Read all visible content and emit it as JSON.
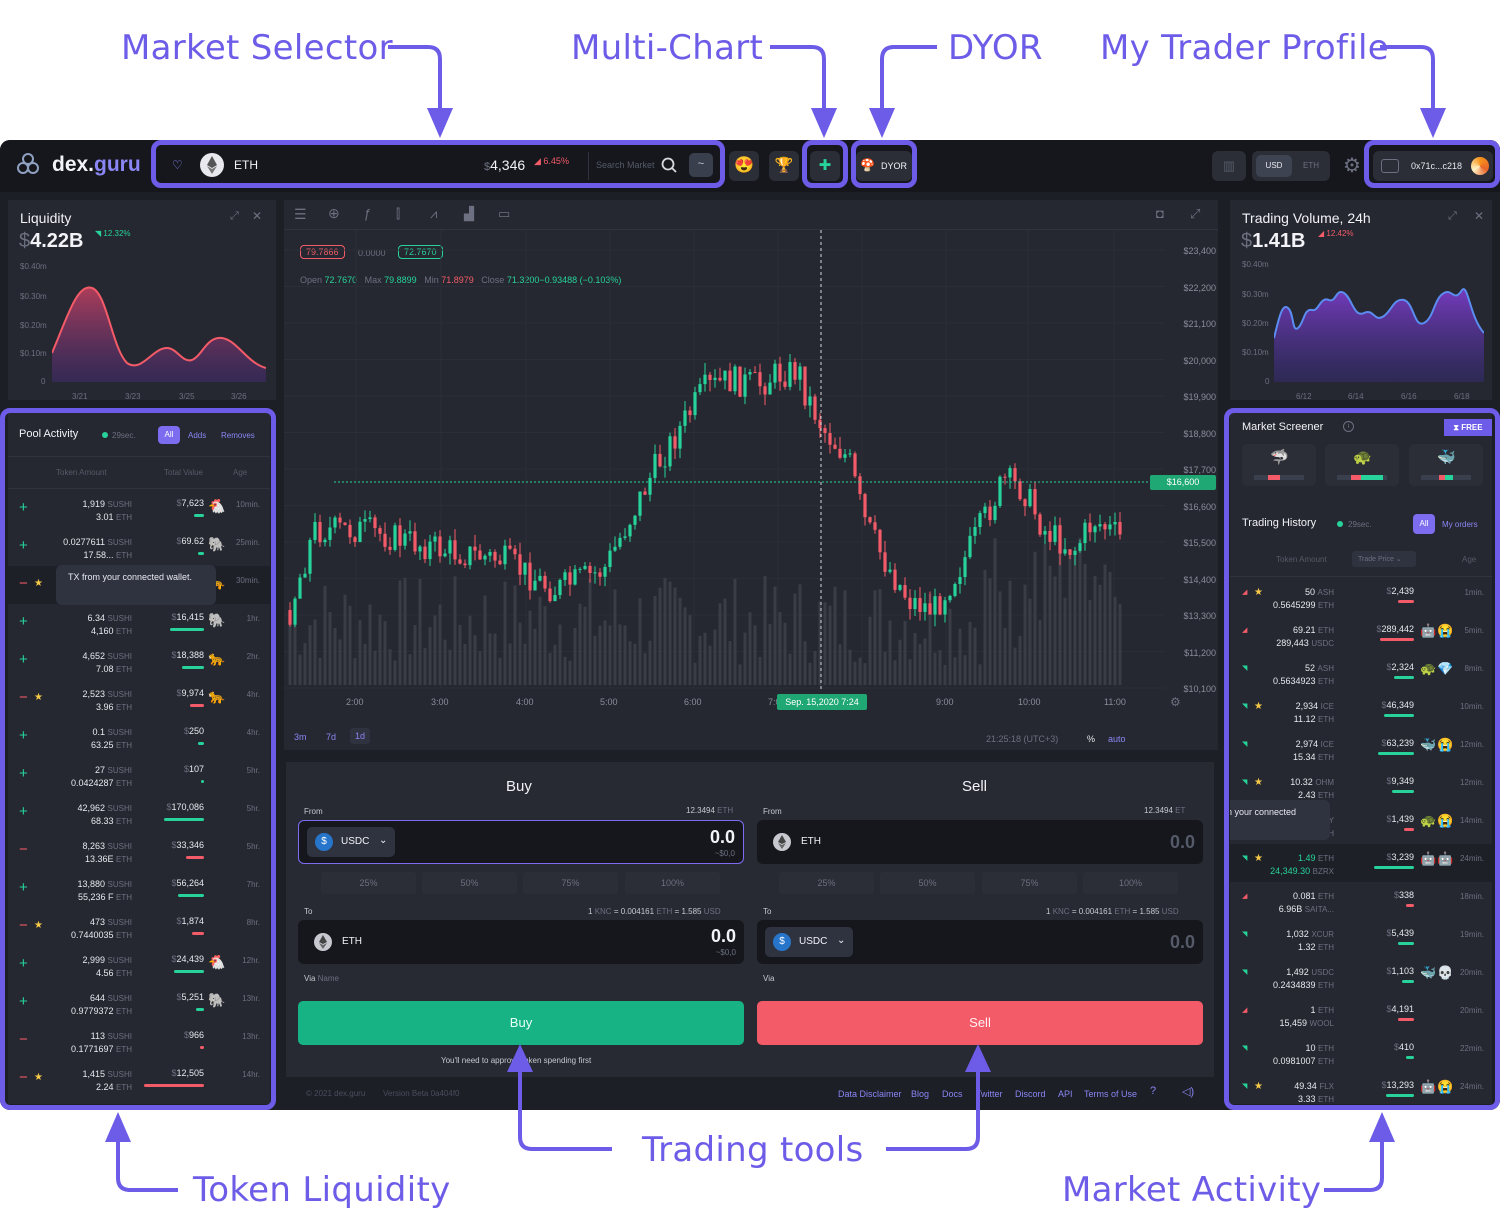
{
  "callouts": {
    "market_selector": "Market Selector",
    "multi_chart": "Multi-Chart",
    "dyor": "DYOR",
    "trader_profile": "My Trader Profile",
    "token_liquidity": "Token Liquidity",
    "trading_tools": "Trading tools",
    "market_activity": "Market Activity"
  },
  "header": {
    "logo_text": "dex.",
    "logo_accent": "guru",
    "token": "ETH",
    "price_symbol": "$",
    "price": "4,346",
    "change": "6.45%",
    "search_placeholder": "Search Market",
    "dyor_label": "DYOR",
    "currency_usd": "USD",
    "currency_eth": "ETH",
    "wallet": "0x71c...c218"
  },
  "liquidity": {
    "title": "Liquidity",
    "value": "4.22B",
    "change": "12.32%",
    "y_ticks": [
      "$0.40m",
      "$0.30m",
      "$0.20m",
      "$0.10m",
      "0"
    ],
    "x_ticks": [
      "3/21",
      "3/23",
      "3/25",
      "3/26"
    ]
  },
  "volume": {
    "title": "Trading Volume, 24h",
    "value": "1.41B",
    "change": "12.42%",
    "y_ticks": [
      "$0.40m",
      "$0.30m",
      "$0.20m",
      "$0.10m",
      "0"
    ],
    "x_ticks": [
      "6/12",
      "6/14",
      "6/16",
      "6/18"
    ]
  },
  "pool": {
    "title": "Pool Activity",
    "updated": "29sec.",
    "filters": [
      "All",
      "Adds",
      "Removes"
    ],
    "col_amount": "Token Amount",
    "col_value": "Total Value",
    "col_age": "Age",
    "tooltip": "TX from your connected wallet.",
    "rows": [
      {
        "sign": "+",
        "a1": "1,919",
        "u1": "SUSHI",
        "a2": "3.01",
        "u2": "ETH",
        "val": "7,623",
        "age": "10min.",
        "icon": "🐔",
        "star": false
      },
      {
        "sign": "+",
        "a1": "0.0277611",
        "u1": "SUSHI",
        "a2": "17.58...",
        "u2": "ETH",
        "val": "69.62",
        "age": "25min.",
        "icon": "🐘",
        "star": false
      },
      {
        "sign": "−",
        "a1": "",
        "u1": "",
        "a2": "",
        "u2": "",
        "val": "",
        "age": "30min.",
        "icon": "🐆",
        "star": true
      },
      {
        "sign": "+",
        "a1": "6.34",
        "u1": "SUSHI",
        "a2": "4,160",
        "u2": "ETH",
        "val": "16,415",
        "age": "1hr.",
        "icon": "🐘",
        "star": false
      },
      {
        "sign": "+",
        "a1": "4,652",
        "u1": "SUSHI",
        "a2": "7.08",
        "u2": "ETH",
        "val": "18,388",
        "age": "2hr.",
        "icon": "🐆",
        "star": false
      },
      {
        "sign": "−",
        "a1": "2,523",
        "u1": "SUSHI",
        "a2": "3.96",
        "u2": "ETH",
        "val": "9,974",
        "age": "4hr.",
        "icon": "🐆",
        "star": true
      },
      {
        "sign": "+",
        "a1": "0.1",
        "u1": "SUSHI",
        "a2": "63.25",
        "u2": "ETH",
        "val": "250",
        "age": "4hr.",
        "icon": "",
        "star": false
      },
      {
        "sign": "+",
        "a1": "27",
        "u1": "SUSHI",
        "a2": "0.0424287",
        "u2": "ETH",
        "val": "107",
        "age": "5hr.",
        "icon": "",
        "star": false
      },
      {
        "sign": "+",
        "a1": "42,962",
        "u1": "SUSHI",
        "a2": "68.33",
        "u2": "ETH",
        "val": "170,086",
        "age": "5hr.",
        "icon": "",
        "star": false
      },
      {
        "sign": "−",
        "a1": "8,263",
        "u1": "SUSHI",
        "a2": "13.36E",
        "u2": "ETH",
        "val": "33,346",
        "age": "5hr.",
        "icon": "",
        "star": false
      },
      {
        "sign": "+",
        "a1": "13,880",
        "u1": "SUSHI",
        "a2": "55,236 F",
        "u2": "ETH",
        "val": "56,264",
        "age": "7hr.",
        "icon": "",
        "star": false
      },
      {
        "sign": "−",
        "a1": "473",
        "u1": "SUSHI",
        "a2": "0.7440035",
        "u2": "ETH",
        "val": "1,874",
        "age": "8hr.",
        "icon": "",
        "star": true
      },
      {
        "sign": "+",
        "a1": "2,999",
        "u1": "SUSHI",
        "a2": "4.56",
        "u2": "ETH",
        "val": "24,439",
        "age": "12hr.",
        "icon": "🐔",
        "star": false
      },
      {
        "sign": "+",
        "a1": "644",
        "u1": "SUSHI",
        "a2": "0.9779372",
        "u2": "ETH",
        "val": "5,251",
        "age": "13hr.",
        "icon": "🐘",
        "star": false
      },
      {
        "sign": "−",
        "a1": "113",
        "u1": "SUSHI",
        "a2": "0.1771697",
        "u2": "ETH",
        "val": "966",
        "age": "13hr.",
        "icon": "",
        "star": false
      },
      {
        "sign": "−",
        "a1": "1,415",
        "u1": "SUSHI",
        "a2": "2.24",
        "u2": "ETH",
        "val": "12,505",
        "age": "14hr.",
        "icon": "",
        "star": true
      }
    ]
  },
  "chart": {
    "ohlc_box1": "79.7866",
    "ohlc_mid": "0.0000",
    "ohlc_box2": "72.7670",
    "open_label": "Open",
    "open": "72.7670",
    "max_label": "Max",
    "max": "79.8899",
    "min_label": "Min",
    "min": "71.8979",
    "close_label": "Close",
    "close": "71.3200−0.93488 (−0.103%)",
    "y_ticks": [
      "$23,400",
      "$22,200",
      "$21,100",
      "$20,000",
      "$19,900",
      "$18,800",
      "$17,700",
      "$16,600",
      "$15,500",
      "$14,400",
      "$13,300",
      "$11,200",
      "$10,100"
    ],
    "current_price": "$16,600",
    "x_ticks": [
      "2:00",
      "3:00",
      "4:00",
      "5:00",
      "6:00",
      "7:00",
      "9:00",
      "10:00",
      "11:00"
    ],
    "crosshair_label": "Sep. 15,2020 7:24",
    "periods": [
      "3m",
      "7d",
      "1d"
    ],
    "time": "21:25:18 (UTC+3)",
    "pct": "%",
    "auto": "auto"
  },
  "buy": {
    "title": "Buy",
    "from": "From",
    "balance": "12.3494",
    "balance_unit": "ETH",
    "from_token": "USDC",
    "amount": "0.0",
    "amount_usd": "~$0,0",
    "pcts": [
      "25%",
      "50%",
      "75%",
      "100%"
    ],
    "to": "To",
    "rate": "1",
    "rate_u1": "KNC",
    "rate_eq": "= 0.004161",
    "rate_u2": "ETH",
    "rate_usd": "= 1.585",
    "rate_u3": "USD",
    "to_token": "ETH",
    "to_amount": "0.0",
    "to_usd": "~$0,0",
    "via": "Via",
    "via_name": "Name",
    "button": "Buy",
    "note": "You'll need to approve token spending first"
  },
  "sell": {
    "title": "Sell",
    "from": "From",
    "balance": "12.3494",
    "balance_unit": "ET",
    "from_token": "ETH",
    "amount": "0.0",
    "pcts": [
      "25%",
      "50%",
      "75%",
      "100%"
    ],
    "to": "To",
    "rate": "1",
    "rate_u1": "KNC",
    "rate_eq": "= 0.004161",
    "rate_u2": "ETH",
    "rate_usd": "= 1.585",
    "rate_u3": "USD",
    "to_token": "USDC",
    "to_amount": "0.0",
    "via": "Via",
    "button": "Sell"
  },
  "footer": {
    "copyright": "© 2021 dex.guru",
    "version": "Version Beta 0a404f0",
    "links": [
      "Data Disclaimer",
      "Blog",
      "Docs",
      "Twitter",
      "Discord",
      "API",
      "Terms of Use"
    ]
  },
  "screener": {
    "title": "Market Screener",
    "badge": "FREE",
    "icons": [
      "🦈",
      "🐢",
      "🐳"
    ]
  },
  "history": {
    "title": "Trading History",
    "updated": "29sec.",
    "filters": [
      "All",
      "My orders"
    ],
    "col_amount": "Token Amount",
    "col_price": "Trade Price",
    "col_age": "Age",
    "tooltip": "TX from your connected wallet.",
    "rows": [
      {
        "dir": "up",
        "star": true,
        "a1": "50",
        "u1": "ASH",
        "a2": "0.5645299",
        "u2": "ETH",
        "val": "2,439",
        "age": "1min.",
        "icons": ""
      },
      {
        "dir": "up",
        "star": false,
        "a1": "69.21",
        "u1": "ETH",
        "a2": "289,443",
        "u2": "USDC",
        "val": "289,442",
        "age": "5min.",
        "icons": "🤖😭"
      },
      {
        "dir": "down",
        "star": false,
        "a1": "52",
        "u1": "ASH",
        "a2": "0.5634923",
        "u2": "ETH",
        "val": "2,324",
        "age": "8min.",
        "icons": "🐢💎"
      },
      {
        "dir": "down",
        "star": true,
        "a1": "2,934",
        "u1": "ICE",
        "a2": "11.12",
        "u2": "ETH",
        "val": "46,349",
        "age": "10min.",
        "icons": ""
      },
      {
        "dir": "down",
        "star": false,
        "a1": "2,974",
        "u1": "ICE",
        "a2": "15.34",
        "u2": "ETH",
        "val": "63,239",
        "age": "12min.",
        "icons": "🐳😭"
      },
      {
        "dir": "down",
        "star": true,
        "a1": "10.32",
        "u1": "OHM",
        "a2": "2.43",
        "u2": "ETH",
        "val": "9,349",
        "age": "12min.",
        "icons": ""
      },
      {
        "dir": "up",
        "star": false,
        "a1": "",
        "u1": "ZADDY",
        "a2": "",
        "u2": "ETH",
        "val": "1,439",
        "age": "14min.",
        "icons": "🐢😭"
      },
      {
        "dir": "down",
        "star": true,
        "a1": "1.49",
        "u1": "ETH",
        "a2": "24,349.30",
        "u2": "BZRX",
        "val": "3,239",
        "age": "24min.",
        "icons": "🤖🤖"
      },
      {
        "dir": "up",
        "star": false,
        "a1": "0.081",
        "u1": "ETH",
        "a2": "6.96B",
        "u2": "SAITA...",
        "val": "338",
        "age": "18min.",
        "icons": ""
      },
      {
        "dir": "down",
        "star": false,
        "a1": "1,032",
        "u1": "XCUR",
        "a2": "1.32",
        "u2": "ETH",
        "val": "5,439",
        "age": "19min.",
        "icons": ""
      },
      {
        "dir": "down",
        "star": false,
        "a1": "1,492",
        "u1": "USDC",
        "a2": "0.2434839",
        "u2": "ETH",
        "val": "1,103",
        "age": "20min.",
        "icons": "🐳💀"
      },
      {
        "dir": "up",
        "star": false,
        "a1": "1",
        "u1": "ETH",
        "a2": "15,459",
        "u2": "WOOL",
        "val": "4,191",
        "age": "20min.",
        "icons": ""
      },
      {
        "dir": "down",
        "star": false,
        "a1": "10",
        "u1": "ETH",
        "a2": "0.0981007",
        "u2": "ETH",
        "val": "410",
        "age": "22min.",
        "icons": ""
      },
      {
        "dir": "down",
        "star": true,
        "a1": "49.34",
        "u1": "FLX",
        "a2": "3.33",
        "u2": "ETH",
        "val": "13,293",
        "age": "24min.",
        "icons": "🤖😭"
      }
    ]
  }
}
